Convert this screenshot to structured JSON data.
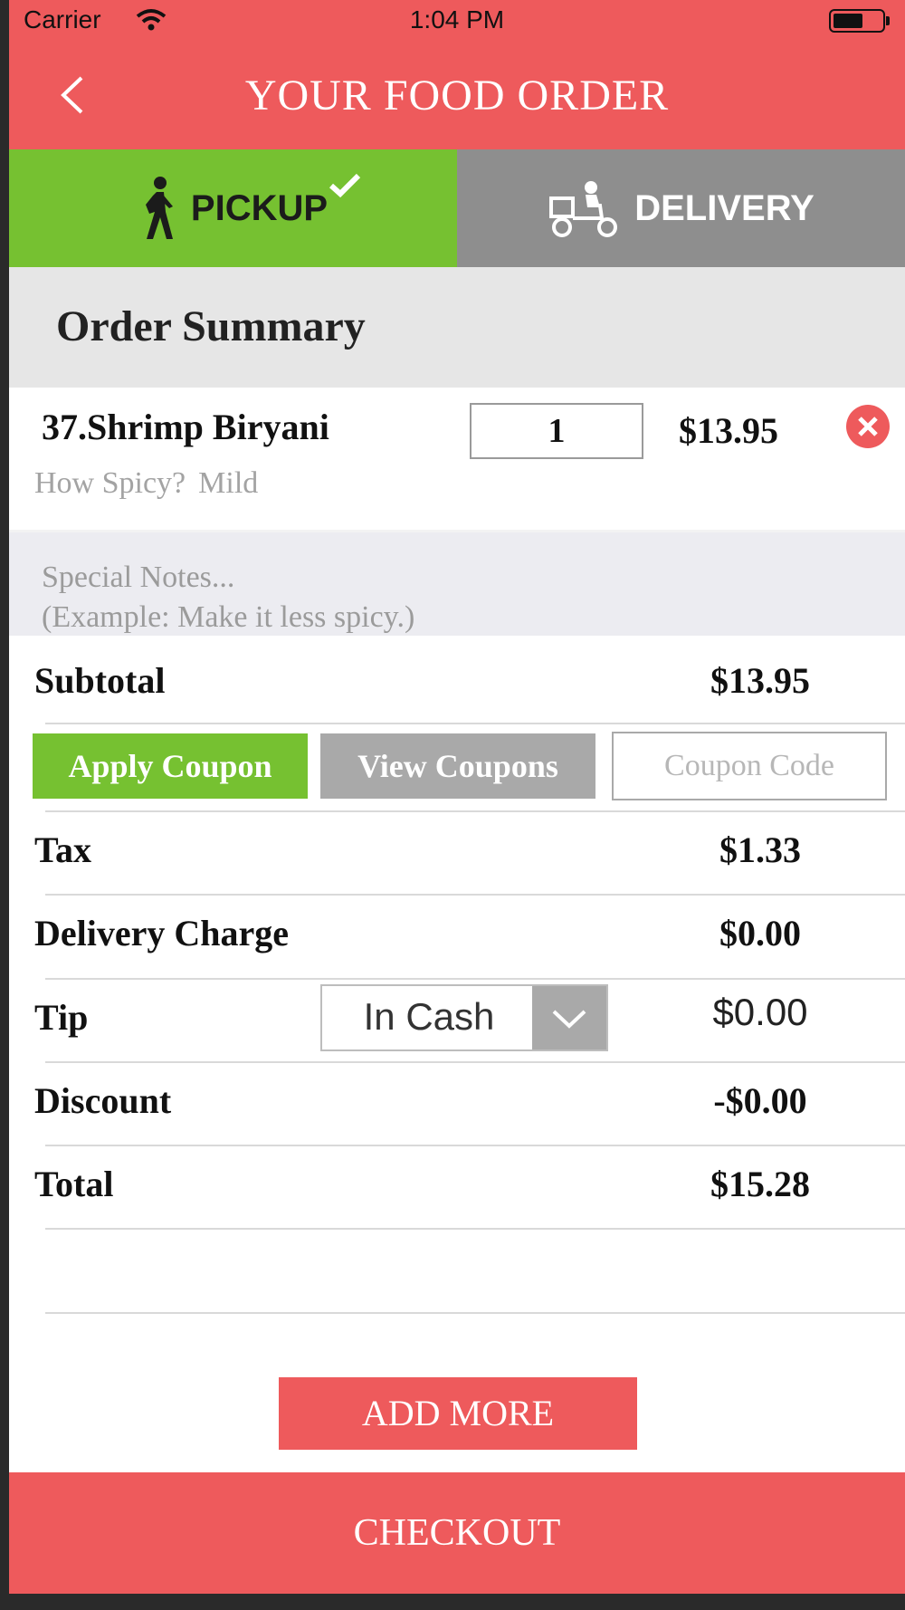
{
  "status_bar": {
    "carrier": "Carrier",
    "time": "1:04 PM"
  },
  "header": {
    "title": "YOUR FOOD ORDER"
  },
  "modes": {
    "pickup": "PICKUP",
    "delivery": "DELIVERY",
    "selected": "pickup"
  },
  "summary": {
    "heading": "Order Summary"
  },
  "item": {
    "name": "37.Shrimp Biryani",
    "quantity": "1",
    "price": "$13.95",
    "option_label": "How Spicy?",
    "option_value": "Mild"
  },
  "notes": {
    "placeholder": "Special Notes...\n(Example: Make it less spicy.)"
  },
  "subtotal": {
    "label": "Subtotal",
    "value": "$13.95"
  },
  "coupon": {
    "apply_label": "Apply Coupon",
    "view_label": "View Coupons",
    "placeholder": "Coupon Code"
  },
  "tax": {
    "label": "Tax",
    "value": "$1.33"
  },
  "delivery_charge": {
    "label": "Delivery Charge",
    "value": "$0.00"
  },
  "tip": {
    "label": "Tip",
    "method": "In Cash",
    "value": "$0.00"
  },
  "discount": {
    "label": "Discount",
    "value": "-$0.00"
  },
  "total": {
    "label": "Total",
    "value": "$15.28"
  },
  "actions": {
    "add_more": "ADD MORE",
    "checkout": "CHECKOUT"
  },
  "colors": {
    "brand_red": "#ee5a5c",
    "pickup_green": "#76c131",
    "delivery_gray": "#8e8e8e",
    "secondary_gray": "#a9a9a9"
  },
  "icons": [
    "wifi-icon",
    "battery-icon",
    "back-chevron-icon",
    "walking-person-icon",
    "checkmark-icon",
    "delivery-scooter-icon",
    "remove-item-icon",
    "dropdown-chevron-icon"
  ]
}
